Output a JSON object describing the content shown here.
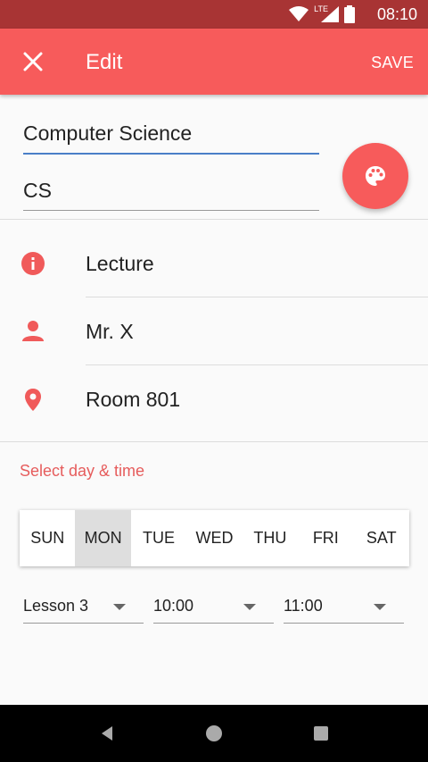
{
  "status_bar": {
    "time": "08:10",
    "network_label": "LTE",
    "icons": [
      "wifi-icon",
      "signal-icon",
      "battery-icon"
    ]
  },
  "app_bar": {
    "title": "Edit",
    "save_label": "SAVE",
    "close_icon": "close-icon"
  },
  "form": {
    "name_value": "Computer Science",
    "short_value": "CS",
    "color_button_icon": "palette-icon"
  },
  "details": [
    {
      "icon": "info-icon",
      "value": "Lecture"
    },
    {
      "icon": "person-icon",
      "value": "Mr. X"
    },
    {
      "icon": "location-icon",
      "value": "Room 801"
    }
  ],
  "schedule": {
    "section_label": "Select day & time",
    "days": [
      "SUN",
      "MON",
      "TUE",
      "WED",
      "THU",
      "FRI",
      "SAT"
    ],
    "selected_day": "MON",
    "lesson": "Lesson 3",
    "start_time": "10:00",
    "end_time": "11:00"
  },
  "colors": {
    "primary": "#f75b5b",
    "status_bar": "#a83434",
    "accent_underline": "#4a7fc8",
    "section_label": "#e65c5c"
  }
}
